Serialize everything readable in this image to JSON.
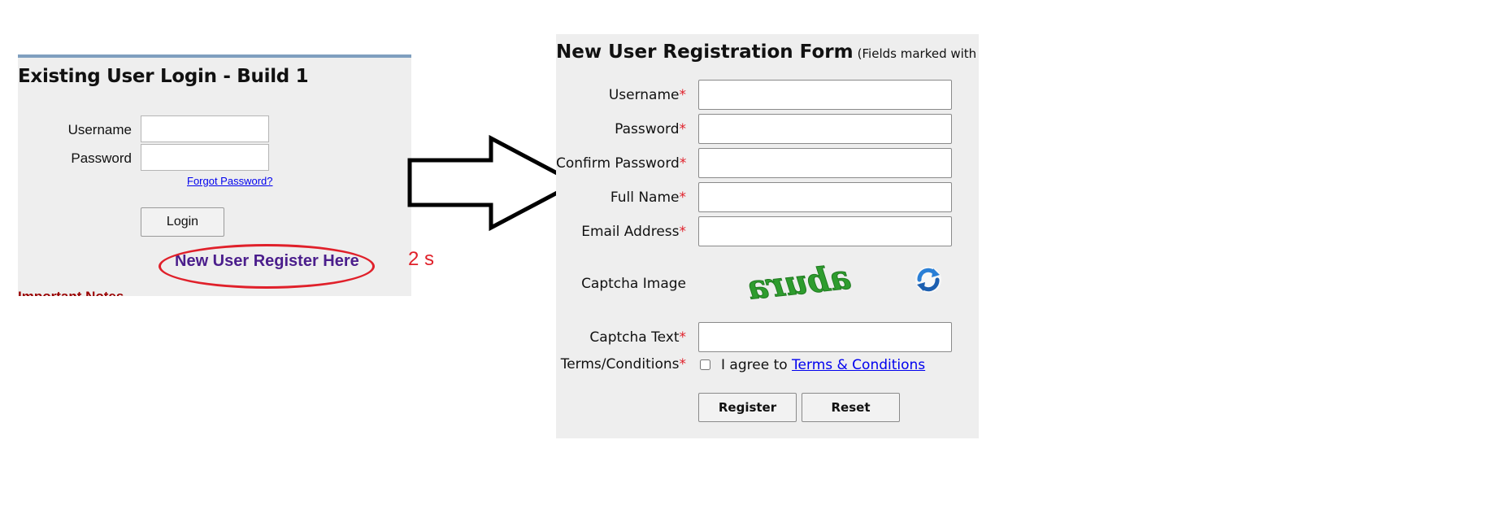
{
  "login": {
    "title": "Existing User Login - Build 1",
    "username_label": "Username",
    "username_value": "",
    "password_label": "Password",
    "password_value": "",
    "forgot_password": "Forgot Password?",
    "login_button": "Login",
    "register_link": "New User Register Here",
    "cut_off_text": "Important Notes"
  },
  "annotation": {
    "delay": "2 s",
    "highlight_color": "#e0202a"
  },
  "registration": {
    "title": "New User Registration Form",
    "title_note": "(Fields marked with Re",
    "required_marker": "*",
    "fields": [
      {
        "label": "Username",
        "required": true,
        "value": ""
      },
      {
        "label": "Password",
        "required": true,
        "value": ""
      },
      {
        "label": "Confirm Password",
        "required": true,
        "value": ""
      },
      {
        "label": "Full Name",
        "required": true,
        "value": ""
      },
      {
        "label": "Email Address",
        "required": true,
        "value": ""
      }
    ],
    "captcha_image_label": "Captcha Image",
    "captcha_glyphs": "abura",
    "captcha_refresh_icon": "refresh-icon",
    "captcha_text_label": "Captcha Text",
    "captcha_text_value": "",
    "terms_label": "Terms/Conditions",
    "terms_checked": false,
    "terms_text": "I agree to",
    "terms_link": "Terms & Conditions",
    "register_button": "Register",
    "reset_button": "Reset"
  }
}
